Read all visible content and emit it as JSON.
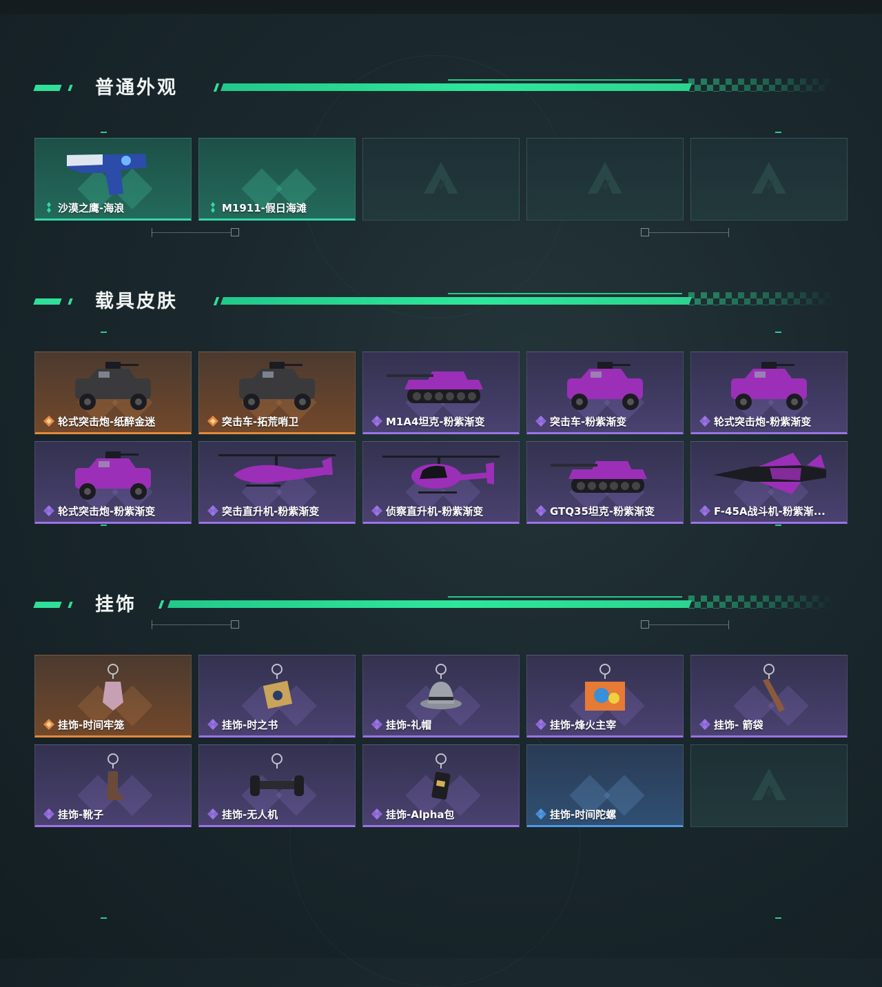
{
  "sections": [
    {
      "title": "普通外观",
      "items": [
        {
          "label": "沙漠之鹰-海浪",
          "rarity": "green",
          "icon": "pistol-icon"
        },
        {
          "label": "M1911-假日海滩",
          "rarity": "green",
          "icon": ""
        },
        {
          "label": "",
          "rarity": "empty",
          "icon": "logo-watermark-icon"
        },
        {
          "label": "",
          "rarity": "empty",
          "icon": "logo-watermark-icon"
        },
        {
          "label": "",
          "rarity": "empty",
          "icon": "logo-watermark-icon"
        }
      ]
    },
    {
      "title": "载具皮肤",
      "items": [
        {
          "label": "轮式突击炮-纸醉金迷",
          "rarity": "orange",
          "icon": "armored-car-icon"
        },
        {
          "label": "突击车-拓荒哨卫",
          "rarity": "orange",
          "icon": "assault-vehicle-icon"
        },
        {
          "label": "M1A4坦克-粉紫渐变",
          "rarity": "purple",
          "icon": "tank-icon"
        },
        {
          "label": "突击车-粉紫渐变",
          "rarity": "purple",
          "icon": "assault-vehicle-icon"
        },
        {
          "label": "轮式突击炮-粉紫渐变",
          "rarity": "purple",
          "icon": "armored-car-icon"
        },
        {
          "label": "轮式突击炮-粉紫渐变",
          "rarity": "purple",
          "icon": "armored-car-icon"
        },
        {
          "label": "突击直升机-粉紫渐变",
          "rarity": "purple",
          "icon": "attack-helicopter-icon"
        },
        {
          "label": "侦察直升机-粉紫渐变",
          "rarity": "purple",
          "icon": "scout-helicopter-icon"
        },
        {
          "label": "GTQ35坦克-粉紫渐变",
          "rarity": "purple",
          "icon": "tank-icon"
        },
        {
          "label": "F-45A战斗机-粉紫渐...",
          "rarity": "purple",
          "icon": "fighter-jet-icon"
        }
      ]
    },
    {
      "title": "挂饰",
      "items": [
        {
          "label": "挂饰-时间牢笼",
          "rarity": "orange",
          "icon": "cage-charm-icon"
        },
        {
          "label": "挂饰-时之书",
          "rarity": "purple",
          "icon": "book-charm-icon"
        },
        {
          "label": "挂饰-礼帽",
          "rarity": "purple",
          "icon": "hat-charm-icon"
        },
        {
          "label": "挂饰-烽火主宰",
          "rarity": "purple",
          "icon": "container-charm-icon"
        },
        {
          "label": "挂饰- 箭袋",
          "rarity": "purple",
          "icon": "quiver-charm-icon"
        },
        {
          "label": "挂饰-靴子",
          "rarity": "purple",
          "icon": "boot-charm-icon"
        },
        {
          "label": "挂饰-无人机",
          "rarity": "purple",
          "icon": "drone-charm-icon"
        },
        {
          "label": "挂饰-Alpha包",
          "rarity": "purple",
          "icon": "bag-charm-icon"
        },
        {
          "label": "挂饰-时间陀螺",
          "rarity": "blue",
          "icon": ""
        },
        {
          "label": "",
          "rarity": "empty",
          "icon": "logo-watermark-icon"
        }
      ]
    }
  ],
  "colors": {
    "accent": "#2fe098",
    "green": "#34d8a6",
    "orange": "#e58a3a",
    "purple": "#9c73e8",
    "blue": "#4e9ae6"
  }
}
